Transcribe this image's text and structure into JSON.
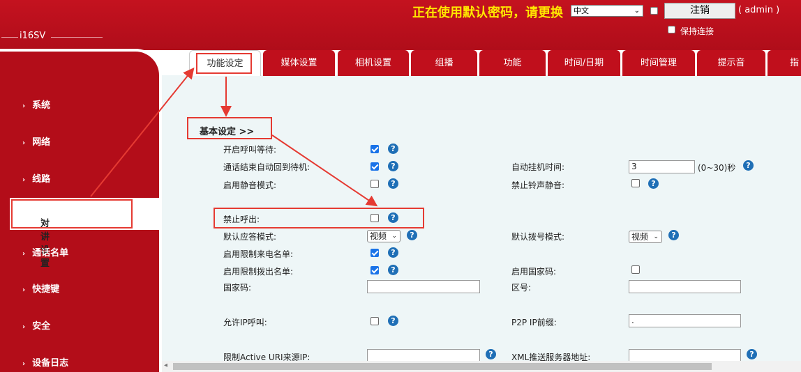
{
  "header": {
    "model": "i16SV",
    "warning": "正在使用默认密码，请更换",
    "language": "中文",
    "logout_label": "注销",
    "user": "( admin )",
    "keep_connected": "保持连接"
  },
  "sidebar": {
    "items": [
      {
        "label": "系统"
      },
      {
        "label": "网络"
      },
      {
        "label": "线路"
      },
      {
        "label": "对讲设置"
      },
      {
        "label": "通话名单"
      },
      {
        "label": "快捷键"
      },
      {
        "label": "安全"
      },
      {
        "label": "设备日志"
      }
    ],
    "active_index": 3
  },
  "tabs": [
    {
      "label": "功能设定"
    },
    {
      "label": "媒体设置"
    },
    {
      "label": "相机设置"
    },
    {
      "label": "组播"
    },
    {
      "label": "功能"
    },
    {
      "label": "时间/日期"
    },
    {
      "label": "时间管理"
    },
    {
      "label": "提示音"
    },
    {
      "label": "指"
    }
  ],
  "section_title": "基本设定 >>",
  "left_fields": [
    {
      "label": "开启呼叫等待:",
      "type": "checkbox",
      "checked": true
    },
    {
      "label": "通话结束自动回到待机:",
      "type": "checkbox",
      "checked": true
    },
    {
      "label": "启用静音模式:",
      "type": "checkbox",
      "checked": false
    },
    {
      "label": "禁止呼出:",
      "type": "checkbox",
      "checked": false
    },
    {
      "label": "默认应答模式:",
      "type": "select",
      "value": "视频"
    },
    {
      "label": "启用限制来电名单:",
      "type": "checkbox",
      "checked": true
    },
    {
      "label": "启用限制拨出名单:",
      "type": "checkbox",
      "checked": true
    },
    {
      "label": "国家码:",
      "type": "text",
      "value": ""
    },
    {
      "label": "允许IP呼叫:",
      "type": "checkbox",
      "checked": false
    },
    {
      "label": "限制Active URI来源IP:",
      "type": "text",
      "value": ""
    }
  ],
  "right_fields": [
    {
      "label": "自动挂机时间:",
      "type": "text",
      "value": "3",
      "suffix": "(0~30)秒"
    },
    {
      "label": "禁止铃声静音:",
      "type": "checkbox",
      "checked": false
    },
    {
      "label": "默认拨号模式:",
      "type": "select",
      "value": "视频"
    },
    {
      "label": "启用国家码:",
      "type": "checkbox",
      "checked": false
    },
    {
      "label": "区号:",
      "type": "text",
      "value": ""
    },
    {
      "label": "P2P IP前缀:",
      "type": "text",
      "value": "."
    },
    {
      "label": "XML推送服务器地址:",
      "type": "text",
      "value": ""
    }
  ],
  "help_glyph": "?",
  "colors": {
    "brand_red": "#b30d19",
    "warning_yellow": "#ffe600",
    "annotation_red": "#e53a32",
    "checkbox_blue": "#1a73e8",
    "help_blue": "#1f6fb6"
  }
}
